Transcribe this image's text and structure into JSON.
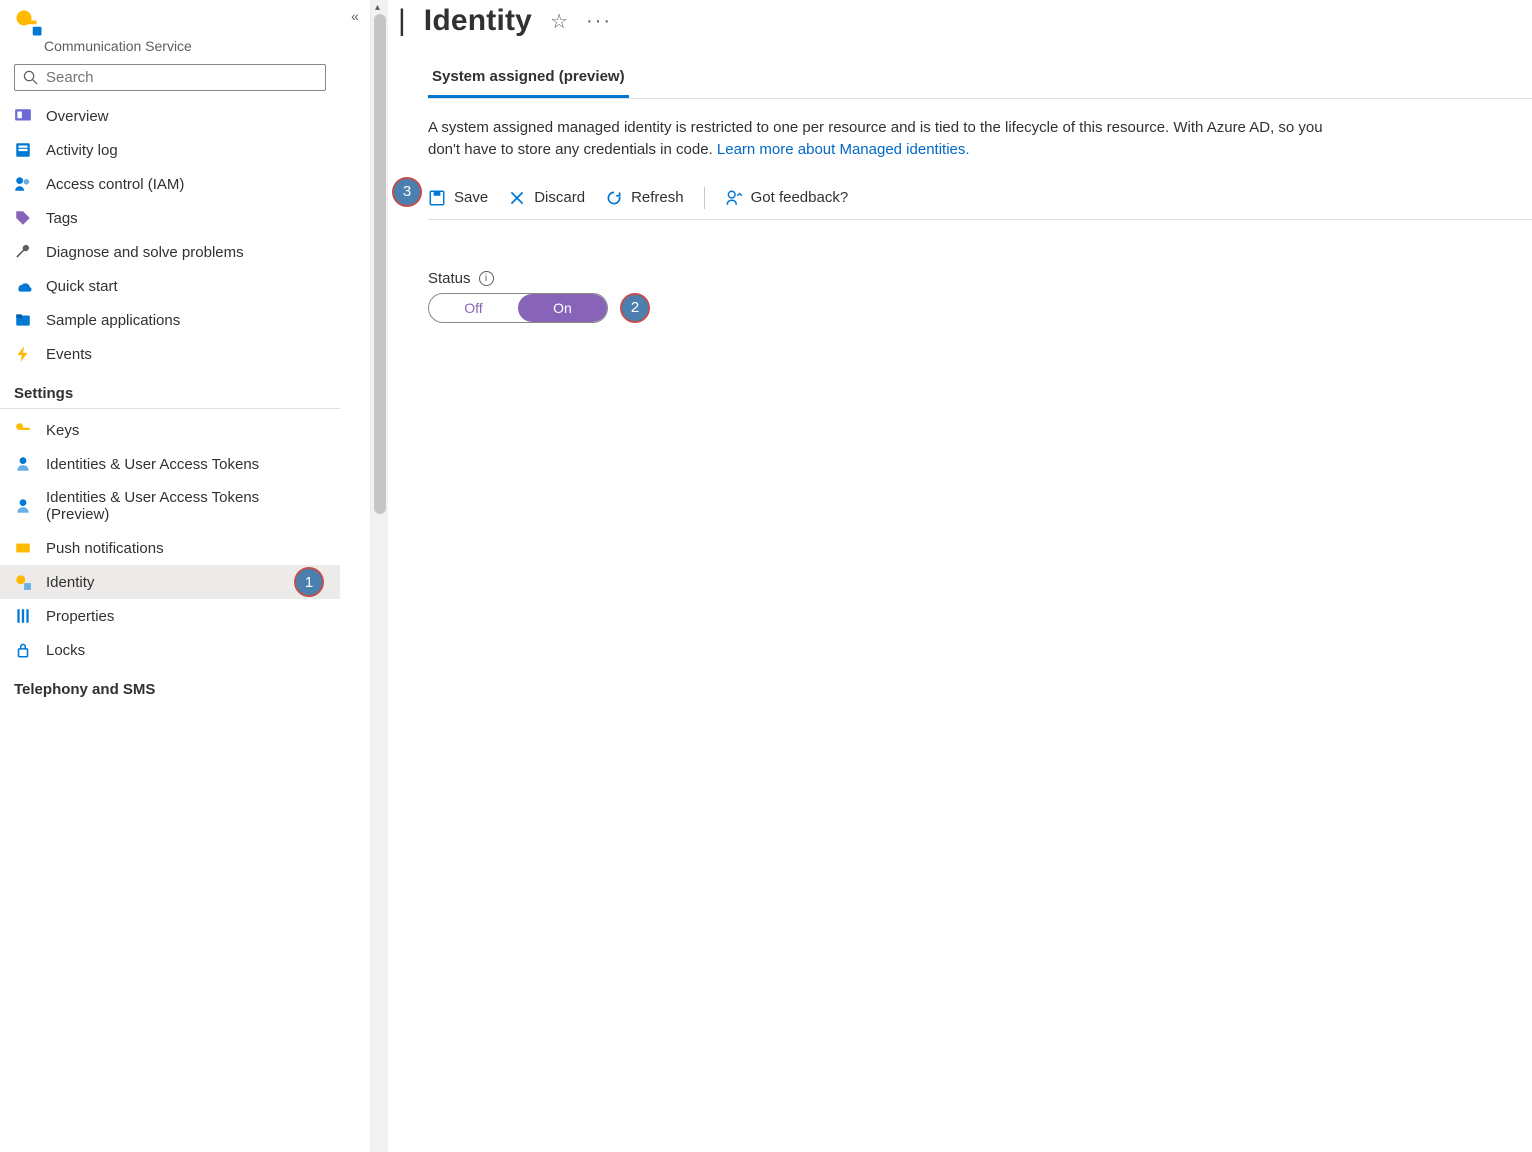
{
  "header": {
    "service_type": "Communication Service",
    "title": "Identity"
  },
  "search": {
    "placeholder": "Search"
  },
  "sidebar": {
    "items": [
      {
        "label": "Overview",
        "icon": "overview"
      },
      {
        "label": "Activity log",
        "icon": "activity"
      },
      {
        "label": "Access control (IAM)",
        "icon": "iam"
      },
      {
        "label": "Tags",
        "icon": "tag"
      },
      {
        "label": "Diagnose and solve problems",
        "icon": "wrench"
      },
      {
        "label": "Quick start",
        "icon": "arrow"
      },
      {
        "label": "Sample applications",
        "icon": "folder"
      },
      {
        "label": "Events",
        "icon": "bolt"
      }
    ],
    "sections": [
      {
        "title": "Settings",
        "items": [
          {
            "label": "Keys",
            "icon": "key"
          },
          {
            "label": "Identities & User Access Tokens",
            "icon": "user"
          },
          {
            "label": "Identities & User Access Tokens (Preview)",
            "icon": "user"
          },
          {
            "label": "Push notifications",
            "icon": "push"
          },
          {
            "label": "Identity",
            "icon": "identity",
            "active": true
          },
          {
            "label": "Properties",
            "icon": "props"
          },
          {
            "label": "Locks",
            "icon": "lock"
          }
        ]
      },
      {
        "title": "Telephony and SMS",
        "items": []
      }
    ]
  },
  "main": {
    "tab": "System assigned (preview)",
    "description": "A system assigned managed identity is restricted to one per resource and is tied to the lifecycle of this resource. With Azure AD, so you don't have to store any credentials in code.",
    "learn_link": "Learn more about Managed identities.",
    "toolbar": {
      "save": "Save",
      "discard": "Discard",
      "refresh": "Refresh",
      "feedback": "Got feedback?"
    },
    "status": {
      "label": "Status",
      "off": "Off",
      "on": "On",
      "value": "On"
    }
  },
  "callouts": {
    "c1": "1",
    "c2": "2",
    "c3": "3"
  }
}
